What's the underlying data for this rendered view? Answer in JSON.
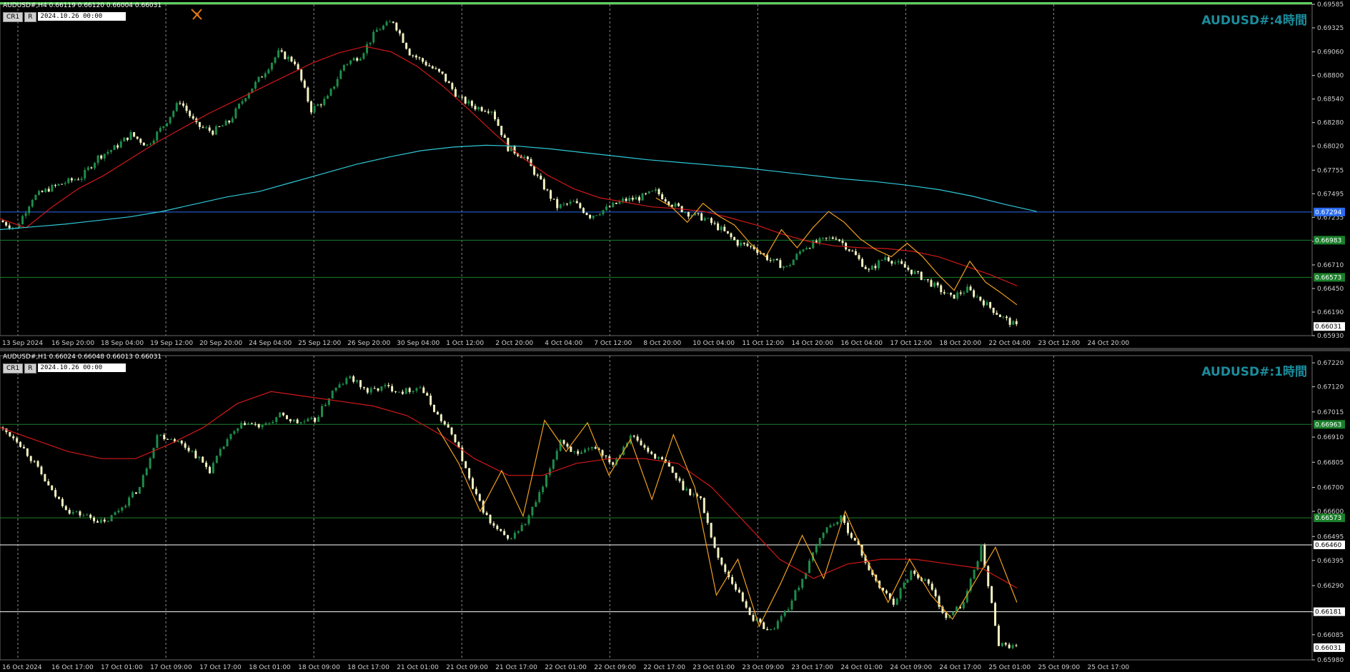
{
  "colors": {
    "background": "#000000",
    "bull": "#1e8c4a",
    "bear": "#f2f2c2",
    "ma_fast": "#d01818",
    "ma_slow": "#2ec8d8",
    "zigzag": "#f0a020",
    "grid": "#8a8a8a",
    "axis_text": "#cfcfcf",
    "h4_blue": "#2a6cf0",
    "h_green": "#1a7f2a",
    "h_white": "#ffffff",
    "title": "#1b8c9c"
  },
  "icons": {
    "cursor": "crosshair-pencil-icon"
  },
  "panes": {
    "top": {
      "header": "AUDUSD#,H4  0.66119 0.66120 0.66004 0.66031",
      "title": "AUDUSD#:4時間",
      "controls": {
        "cr": "CR1",
        "r": "R",
        "date": "2024.10.26 00:00"
      }
    },
    "bottom": {
      "header": "AUDUSD#,H1  0.66024 0.66048 0.66013 0.66031",
      "title": "AUDUSD#:1時間",
      "controls": {
        "cr": "CR1",
        "r": "R",
        "date": "2024.10.26 00:00"
      }
    }
  },
  "chart_data": [
    {
      "type": "candlestick",
      "title": "AUDUSD#:4時間",
      "timeframe": "H4",
      "ylim": [
        0.6593,
        0.69585
      ],
      "y_ticks": [
        "0.69585",
        "0.69325",
        "0.69060",
        "0.68800",
        "0.68540",
        "0.68280",
        "0.68020",
        "0.67755",
        "0.67495",
        "0.67235",
        "0.66970",
        "0.66710",
        "0.66450",
        "0.66190",
        "0.65930"
      ],
      "x_labels": [
        "13 Sep 2024",
        "16 Sep 20:00",
        "18 Sep 04:00",
        "19 Sep 12:00",
        "20 Sep 20:00",
        "24 Sep 04:00",
        "25 Sep 12:00",
        "26 Sep 20:00",
        "30 Sep 04:00",
        "1 Oct 12:00",
        "2 Oct 20:00",
        "4 Oct 04:00",
        "7 Oct 12:00",
        "8 Oct 20:00",
        "10 Oct 04:00",
        "11 Oct 12:00",
        "14 Oct 20:00",
        "16 Oct 04:00",
        "17 Oct 12:00",
        "18 Oct 20:00",
        "22 Oct 04:00",
        "23 Oct 12:00",
        "24 Oct 20:00"
      ],
      "close_path": [
        0.672,
        0.6711,
        0.6745,
        0.6755,
        0.6762,
        0.6768,
        0.679,
        0.68,
        0.6815,
        0.6803,
        0.6825,
        0.6852,
        0.6825,
        0.6818,
        0.6829,
        0.6858,
        0.688,
        0.6905,
        0.6895,
        0.6842,
        0.6855,
        0.6892,
        0.6902,
        0.693,
        0.694,
        0.6905,
        0.6893,
        0.688,
        0.6855,
        0.6845,
        0.6842,
        0.68,
        0.679,
        0.6762,
        0.6735,
        0.674,
        0.6725,
        0.6733,
        0.6742,
        0.6745,
        0.6752,
        0.6738,
        0.6728,
        0.6722,
        0.671,
        0.6695,
        0.669,
        0.6676,
        0.6668,
        0.669,
        0.6697,
        0.6702,
        0.6685,
        0.6664,
        0.668,
        0.667,
        0.666,
        0.6648,
        0.6635,
        0.6644,
        0.663,
        0.6615,
        0.66031
      ],
      "series": [
        {
          "name": "",
          "values": [
            0.6722,
            0.6712,
            0.6735,
            0.6755,
            0.677,
            0.6788,
            0.6806,
            0.6822,
            0.6838,
            0.6852,
            0.6866,
            0.688,
            0.6894,
            0.6905,
            0.6912,
            0.6906,
            0.689,
            0.6868,
            0.6842,
            0.6815,
            0.679,
            0.677,
            0.6755,
            0.6745,
            0.674,
            0.6735,
            0.6733,
            0.673,
            0.6723,
            0.6715,
            0.6705,
            0.6697,
            0.6692,
            0.669,
            0.6689,
            0.6686,
            0.668,
            0.667,
            0.666,
            0.6648
          ]
        },
        {
          "name": "",
          "values": [
            0.671,
            0.6713,
            0.6716,
            0.672,
            0.6724,
            0.673,
            0.6738,
            0.6746,
            0.6752,
            0.6762,
            0.6772,
            0.6782,
            0.679,
            0.6797,
            0.6801,
            0.6803,
            0.6802,
            0.6799,
            0.6795,
            0.6791,
            0.6787,
            0.6784,
            0.6781,
            0.6778,
            0.6774,
            0.677,
            0.6766,
            0.6763,
            0.6759,
            0.6754,
            0.6747,
            0.6738,
            0.673
          ]
        }
      ],
      "zigzag": [
        0.6745,
        0.6735,
        0.6718,
        0.6739,
        0.6725,
        0.6715,
        0.6695,
        0.668,
        0.671,
        0.669,
        0.6712,
        0.673,
        0.6718,
        0.67,
        0.6688,
        0.668,
        0.6695,
        0.668,
        0.666,
        0.6643,
        0.6675,
        0.6652,
        0.664,
        0.6627
      ],
      "hlines": [
        {
          "value": 0.67294,
          "label": "0.67294",
          "color": "h4_blue"
        },
        {
          "value": 0.66983,
          "label": "0.66983",
          "color": "h_green"
        },
        {
          "value": 0.66573,
          "label": "0.66573",
          "color": "h_green"
        }
      ],
      "last_price": "0.66031"
    },
    {
      "type": "candlestick",
      "title": "AUDUSD#:1時間",
      "timeframe": "H1",
      "ylim": [
        0.6598,
        0.6725
      ],
      "y_ticks": [
        "0.67220",
        "0.67120",
        "0.67015",
        "0.66910",
        "0.66805",
        "0.66700",
        "0.66600",
        "0.66495",
        "0.66395",
        "0.66290",
        "0.66180",
        "0.66085",
        "0.65980"
      ],
      "x_labels": [
        "16 Oct 2024",
        "16 Oct 17:00",
        "17 Oct 01:00",
        "17 Oct 09:00",
        "17 Oct 17:00",
        "18 Oct 01:00",
        "18 Oct 09:00",
        "18 Oct 17:00",
        "21 Oct 01:00",
        "21 Oct 09:00",
        "21 Oct 17:00",
        "22 Oct 01:00",
        "22 Oct 09:00",
        "22 Oct 17:00",
        "23 Oct 01:00",
        "23 Oct 09:00",
        "23 Oct 17:00",
        "24 Oct 01:00",
        "24 Oct 09:00",
        "24 Oct 17:00",
        "25 Oct 01:00",
        "25 Oct 09:00",
        "25 Oct 17:00"
      ],
      "close_path": [
        0.6695,
        0.669,
        0.668,
        0.6668,
        0.666,
        0.6658,
        0.6655,
        0.6662,
        0.667,
        0.6692,
        0.669,
        0.6685,
        0.6677,
        0.669,
        0.6697,
        0.6695,
        0.67,
        0.6697,
        0.6698,
        0.671,
        0.6716,
        0.671,
        0.6712,
        0.671,
        0.6712,
        0.67,
        0.669,
        0.6669,
        0.6655,
        0.6648,
        0.6655,
        0.667,
        0.669,
        0.6683,
        0.6687,
        0.668,
        0.6692,
        0.6685,
        0.668,
        0.667,
        0.6665,
        0.664,
        0.6628,
        0.6615,
        0.661,
        0.662,
        0.6635,
        0.6652,
        0.6657,
        0.6645,
        0.663,
        0.6622,
        0.6635,
        0.663,
        0.6615,
        0.6622,
        0.6645,
        0.6605,
        0.66031
      ],
      "series": [
        {
          "name": "",
          "values": [
            0.6695,
            0.669,
            0.6685,
            0.6682,
            0.6682,
            0.6688,
            0.6695,
            0.6705,
            0.671,
            0.6708,
            0.6706,
            0.6704,
            0.67,
            0.6692,
            0.6682,
            0.6675,
            0.6675,
            0.668,
            0.6682,
            0.6682,
            0.668,
            0.667,
            0.6655,
            0.664,
            0.6632,
            0.6638,
            0.664,
            0.664,
            0.6638,
            0.6636,
            0.6628
          ]
        }
      ],
      "zigzag": [
        0.6695,
        0.668,
        0.666,
        0.6677,
        0.6658,
        0.6698,
        0.6685,
        0.6697,
        0.6675,
        0.669,
        0.6665,
        0.6692,
        0.667,
        0.6625,
        0.664,
        0.6612,
        0.663,
        0.665,
        0.6632,
        0.666,
        0.664,
        0.6622,
        0.664,
        0.6625,
        0.6615,
        0.663,
        0.6645,
        0.6622
      ],
      "hlines": [
        {
          "value": 0.66963,
          "label": "0.66963",
          "color": "h_green"
        },
        {
          "value": 0.66573,
          "label": "0.66573",
          "color": "h_green"
        },
        {
          "value": 0.6646,
          "label": "0.66460",
          "color": "h_white"
        },
        {
          "value": 0.66181,
          "label": "0.66181",
          "color": "h_white"
        }
      ],
      "last_price": "0.66031"
    }
  ]
}
